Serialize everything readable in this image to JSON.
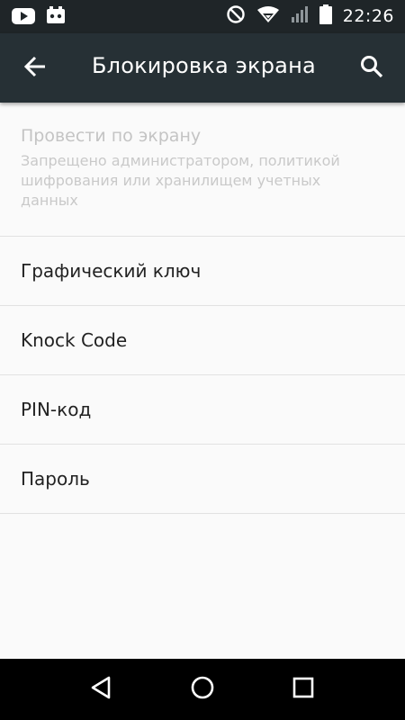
{
  "status_bar": {
    "time": "22:26",
    "icons": [
      "youtube-icon",
      "notification-icon",
      "do-not-disturb-icon",
      "wifi-icon",
      "signal-icon",
      "battery-icon"
    ]
  },
  "toolbar": {
    "title": "Блокировка экрана",
    "back_icon": "back-arrow-icon",
    "search_icon": "search-icon"
  },
  "list": {
    "disabled_item": {
      "title": "Провести по экрану",
      "subtitle": "Запрещено администратором, политикой шифрования или хранилищем учетных данных"
    },
    "items": [
      {
        "label": "Графический ключ"
      },
      {
        "label": "Knock Code"
      },
      {
        "label": "PIN-код"
      },
      {
        "label": "Пароль"
      }
    ]
  },
  "nav_bar": {
    "icons": [
      "back-triangle-icon",
      "home-circle-icon",
      "recents-square-icon"
    ]
  },
  "colors": {
    "toolbar": "#263035",
    "status_bar": "#1f2528",
    "background": "#fafafa",
    "nav_bar": "#000000"
  }
}
